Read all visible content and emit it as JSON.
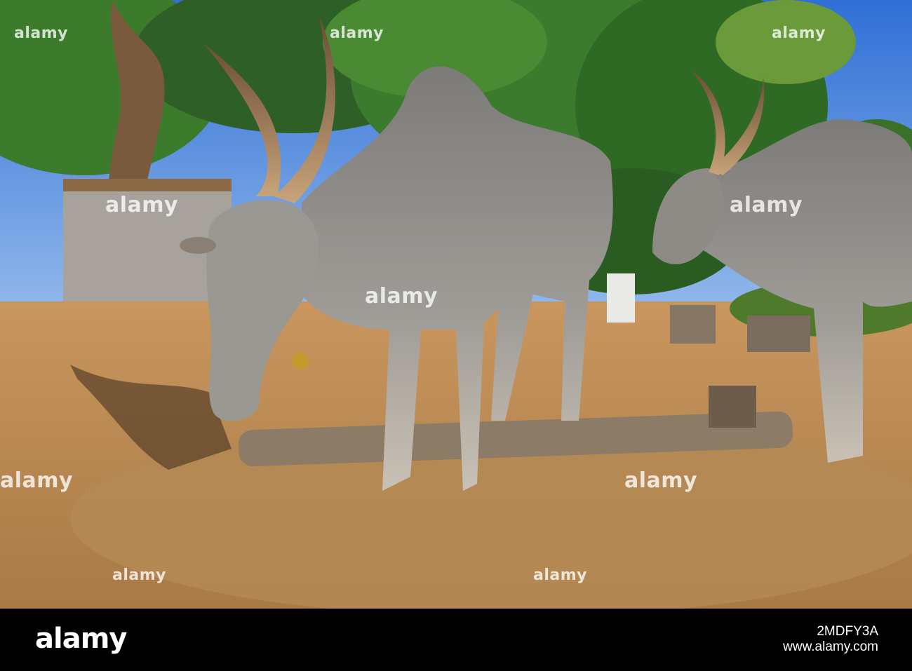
{
  "photo": {
    "subject": "Two grey humped oxen with long curved horns feeding on dry straw in a dusty village yard under trees"
  },
  "watermarks": [
    "alamy",
    "alamy",
    "alamy",
    "alamy",
    "alamy",
    "alamy",
    "alamy",
    "alamy",
    "alamy",
    "alamy"
  ],
  "footer": {
    "brand": "alamy",
    "image_id": "2MDFY3A",
    "url": "www.alamy.com"
  }
}
